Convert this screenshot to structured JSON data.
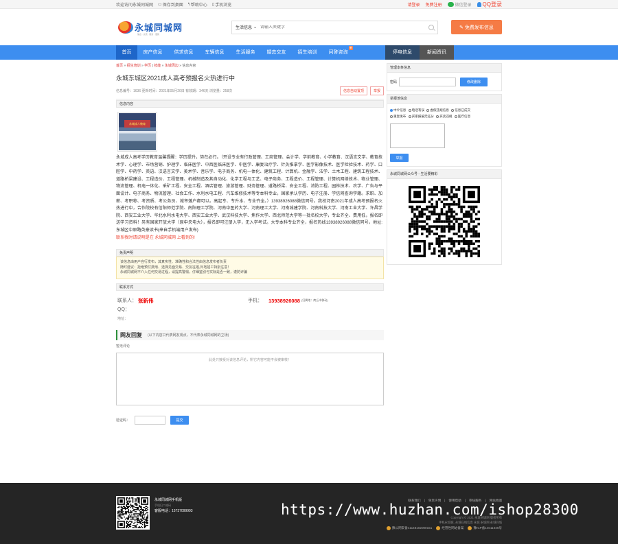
{
  "topbar": {
    "welcome": "欢迎访问永城同城网",
    "save_desktop": "保存到桌面",
    "help": "帮助中心",
    "mobile": "手机浏览",
    "login": "请登录",
    "register": "免费注册",
    "wechat_login": "微信登录",
    "qq_login": "QQ登录"
  },
  "header": {
    "logo_text": "永城同城网",
    "logo_sub": "信息 · 交流 · 服务 · 便民",
    "search_category": "生活信息",
    "search_placeholder": "请输入关键字",
    "post_button": "免费发布信息"
  },
  "nav": {
    "items": [
      "首页",
      "房产信息",
      "供求信息",
      "车辆信息",
      "生活服务",
      "婚恋交友",
      "招生培训",
      "问答咨询"
    ],
    "hot_badge": "新",
    "right_items": [
      "停电信息",
      "新闻资讯"
    ]
  },
  "breadcrumb": {
    "home": "首页",
    "sep": "»",
    "level1": "招生培训",
    "level2": "学历",
    "level3": "技能",
    "level4": "永城周边",
    "current": "信息内容"
  },
  "post": {
    "title": "永城东城区2021成人高考预报名火热进行中",
    "meta": "信息编号：1636 更新时间：2021年05月20日 有效期：346天 浏览量：258次",
    "btn_auto": "信息自动置顶",
    "btn_report": "举报",
    "section_content": "信息内容",
    "photo_sign": "永城成人教育",
    "body": "永城成人高考学历教育温馨提醒：学历提升，势在必行。（开设专业有行政管理、工商管理、会计学、学前教育、小学教育、汉语言文学、教育技术学、心理学、市场营销、护理学、临床医学、中西医临床医学、中医学、康复治疗学、针灸推拿学、医学影像技术、医学检验技术、药学、口腔学、中药学、英语、汉语言文学、美术学、音乐学、电子商务、机电一体化、建筑工程、计算机、金融学、法学、土木工程、建筑工程技术、道路桥梁建设、工程造价、工程管理、机械制造及其自动化、化学工程与工艺、电子商务、工程造价、工程管理、计算机网络技术、物业管理、物流管理、机电一体化、采矿工程、安全工程、酒店管理、旅游管理、财务管理、道路桥梁、安全工程、消防工程、园林技术、农学、广告与平面设计、电子商务、物流管理、社会工作、水利水电工程、汽车维修技术等专本科专业，国家承认学历、电子注册、学信网查询学籍。求职、加薪、考职称、考资质、考公务员、城市落户都可以。高起专、专升本、专业齐全。）13938926088微信同号。我校河南2021年成人高考预报名火热进行中，合作院校有信阳师范学院、南阳理工学院、河南中医药大学、河南理工大学、河南城建学院、河南科技大学、河南工业大学、许昌学院、西安工业大学、华北水利水电大学、西安工业大学、武汉科技大学、焦作大学、西北师范大学等一批名校大学，专业齐全、费用低，报名即送学习资料！另有国家开放大学（原中央电大），报名即可注册入学，无入学考试。大专本科专业齐全，报名热线13938926088微信同号。地址:东城区中原路英豪读书(来自手机端用户发布)",
    "footer_note": "联系我时请说明是在 永城同城网 上看到的!"
  },
  "disclaimer": {
    "title": "免责声明",
    "line1": "该信息由用户自行发布，其真实性、准确性和合法性由信息发布者负责",
    "line2": "随时建议：拒绝预付费用、选择见面交易、交友征婚,外地招工特别注意！",
    "line3": "永城同城网不介入任何交易过程，请提高警惕，仔细鉴别与实际是否一致，谨防诈骗"
  },
  "contact": {
    "title": "联系方式",
    "person_label": "联系人：",
    "person": "张新伟",
    "phone_label": "手机：",
    "phone": "13938926088",
    "phone_loc": "(归属地：商丘市移动)",
    "qq_label": "QQ：",
    "addr_label": "地址："
  },
  "reply": {
    "title": "网友回复",
    "subtitle": "(以下内容只代表网友观点，不代表永城同城网的立场)",
    "none": "暂无评论",
    "textarea_hint": "此处只接受对该信息评论，所它内容可能不会被审核！",
    "verify_label": "验证码：",
    "submit": "提交"
  },
  "sidebar": {
    "manage_title": "管理本条信息",
    "pwd_label": "密码",
    "modify_btn": "修改删除",
    "report_title": "举报该信息",
    "radios": [
      "中介信息",
      "电话有误",
      "虚假违规信息",
      "信息已成交",
      "重复发布",
      "买家报骗无证分",
      "买卖违规",
      "医疗信息"
    ],
    "report_btn": "举报",
    "wechat_title": "永城同城网公众号 - 生活要精彩"
  },
  "footer": {
    "line1": "永城同城网手机版",
    "line2": "手机扫二维码",
    "line3": "客服电话：15737099993",
    "links": [
      "联系我们",
      "免责声明",
      "使用帮助",
      "审核服务",
      "网站地图"
    ],
    "copy1": "Copyright © 2021 永城同城网 版权所有",
    "copy2": "手机永城城, 永城在线信息 永城 永城网 永城同城",
    "badges": [
      "豫公网安备41148102000151",
      "经营性网站备案",
      "豫ICP备14011046号"
    ]
  },
  "watermark": "https://www.huzhan.com/ishop28300"
}
